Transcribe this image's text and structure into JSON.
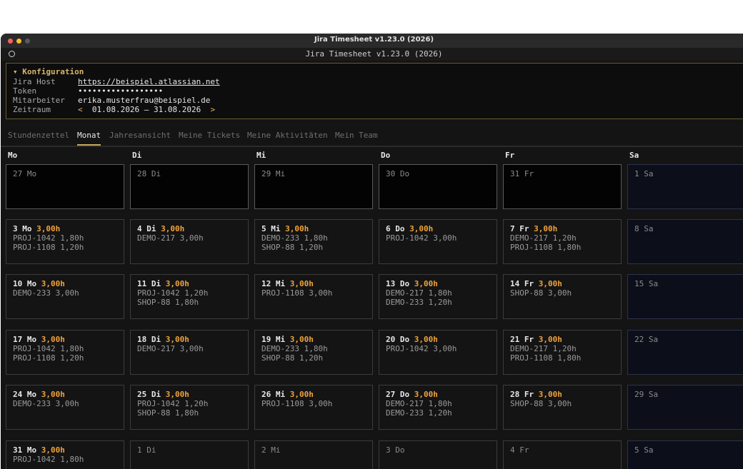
{
  "window": {
    "title": "Jira Timesheet v1.23.0 (2026)"
  },
  "app": {
    "title": "Jira Timesheet v1.23.0 (2026)"
  },
  "config": {
    "title": "▾ Konfiguration",
    "host_label": "Jira Host",
    "host_value": "https://beispiel.atlassian.net",
    "token_label": "Token",
    "token_value": "••••••••••••••••••",
    "employee_label": "Mitarbeiter",
    "employee_value": "erika.musterfrau@beispiel.de",
    "period_label": "Zeitraum",
    "period_prev": "<",
    "period_value": "01.08.2026 – 31.08.2026",
    "period_next": ">"
  },
  "tabs": [
    {
      "label": "Stundenzettel"
    },
    {
      "label": "Monat"
    },
    {
      "label": "Jahresansicht"
    },
    {
      "label": "Meine Tickets"
    },
    {
      "label": "Meine Aktivitäten"
    },
    {
      "label": "Mein Team"
    }
  ],
  "weekdays": [
    "Mo",
    "Di",
    "Mi",
    "Do",
    "Fr",
    "Sa"
  ],
  "weeks": [
    [
      {
        "date": "27 Mo",
        "hours": "",
        "entries": [],
        "kind": "out"
      },
      {
        "date": "28 Di",
        "hours": "",
        "entries": [],
        "kind": "out"
      },
      {
        "date": "29 Mi",
        "hours": "",
        "entries": [],
        "kind": "out"
      },
      {
        "date": "30 Do",
        "hours": "",
        "entries": [],
        "kind": "out"
      },
      {
        "date": "31 Fr",
        "hours": "",
        "entries": [],
        "kind": "out"
      },
      {
        "date": "1 Sa",
        "hours": "",
        "entries": [],
        "kind": "sat"
      }
    ],
    [
      {
        "date": "3 Mo",
        "hours": "3,00h",
        "entries": [
          "PROJ-1042 1,80h",
          "PROJ-1108 1,20h"
        ],
        "kind": "day"
      },
      {
        "date": "4 Di",
        "hours": "3,00h",
        "entries": [
          "DEMO-217 3,00h"
        ],
        "kind": "day"
      },
      {
        "date": "5 Mi",
        "hours": "3,00h",
        "entries": [
          "DEMO-233 1,80h",
          "SHOP-88 1,20h"
        ],
        "kind": "day"
      },
      {
        "date": "6 Do",
        "hours": "3,00h",
        "entries": [
          "PROJ-1042 3,00h"
        ],
        "kind": "day"
      },
      {
        "date": "7 Fr",
        "hours": "3,00h",
        "entries": [
          "DEMO-217 1,20h",
          "PROJ-1108 1,80h"
        ],
        "kind": "day"
      },
      {
        "date": "8 Sa",
        "hours": "",
        "entries": [],
        "kind": "sat"
      }
    ],
    [
      {
        "date": "10 Mo",
        "hours": "3,00h",
        "entries": [
          "DEMO-233 3,00h"
        ],
        "kind": "day"
      },
      {
        "date": "11 Di",
        "hours": "3,00h",
        "entries": [
          "PROJ-1042 1,20h",
          "SHOP-88 1,80h"
        ],
        "kind": "day"
      },
      {
        "date": "12 Mi",
        "hours": "3,00h",
        "entries": [
          "PROJ-1108 3,00h"
        ],
        "kind": "day"
      },
      {
        "date": "13 Do",
        "hours": "3,00h",
        "entries": [
          "DEMO-217 1,80h",
          "DEMO-233 1,20h"
        ],
        "kind": "day"
      },
      {
        "date": "14 Fr",
        "hours": "3,00h",
        "entries": [
          "SHOP-88 3,00h"
        ],
        "kind": "day"
      },
      {
        "date": "15 Sa",
        "hours": "",
        "entries": [],
        "kind": "sat"
      }
    ],
    [
      {
        "date": "17 Mo",
        "hours": "3,00h",
        "entries": [
          "PROJ-1042 1,80h",
          "PROJ-1108 1,20h"
        ],
        "kind": "day"
      },
      {
        "date": "18 Di",
        "hours": "3,00h",
        "entries": [
          "DEMO-217 3,00h"
        ],
        "kind": "day"
      },
      {
        "date": "19 Mi",
        "hours": "3,00h",
        "entries": [
          "DEMO-233 1,80h",
          "SHOP-88 1,20h"
        ],
        "kind": "day"
      },
      {
        "date": "20 Do",
        "hours": "3,00h",
        "entries": [
          "PROJ-1042 3,00h"
        ],
        "kind": "day"
      },
      {
        "date": "21 Fr",
        "hours": "3,00h",
        "entries": [
          "DEMO-217 1,20h",
          "PROJ-1108 1,80h"
        ],
        "kind": "day"
      },
      {
        "date": "22 Sa",
        "hours": "",
        "entries": [],
        "kind": "sat"
      }
    ],
    [
      {
        "date": "24 Mo",
        "hours": "3,00h",
        "entries": [
          "DEMO-233 3,00h"
        ],
        "kind": "day"
      },
      {
        "date": "25 Di",
        "hours": "3,00h",
        "entries": [
          "PROJ-1042 1,20h",
          "SHOP-88 1,80h"
        ],
        "kind": "day"
      },
      {
        "date": "26 Mi",
        "hours": "3,00h",
        "entries": [
          "PROJ-1108 3,00h"
        ],
        "kind": "day"
      },
      {
        "date": "27 Do",
        "hours": "3,00h",
        "entries": [
          "DEMO-217 1,80h",
          "DEMO-233 1,20h"
        ],
        "kind": "day"
      },
      {
        "date": "28 Fr",
        "hours": "3,00h",
        "entries": [
          "SHOP-88 3,00h"
        ],
        "kind": "day"
      },
      {
        "date": "29 Sa",
        "hours": "",
        "entries": [],
        "kind": "sat"
      }
    ],
    [
      {
        "date": "31 Mo",
        "hours": "3,00h",
        "entries": [
          "PROJ-1042 1,80h"
        ],
        "kind": "day"
      },
      {
        "date": "1 Di",
        "hours": "",
        "entries": [],
        "kind": "empty"
      },
      {
        "date": "2 Mi",
        "hours": "",
        "entries": [],
        "kind": "empty"
      },
      {
        "date": "3 Do",
        "hours": "",
        "entries": [],
        "kind": "empty"
      },
      {
        "date": "4 Fr",
        "hours": "",
        "entries": [],
        "kind": "empty"
      },
      {
        "date": "5 Sa",
        "hours": "",
        "entries": [],
        "kind": "sat"
      }
    ]
  ]
}
